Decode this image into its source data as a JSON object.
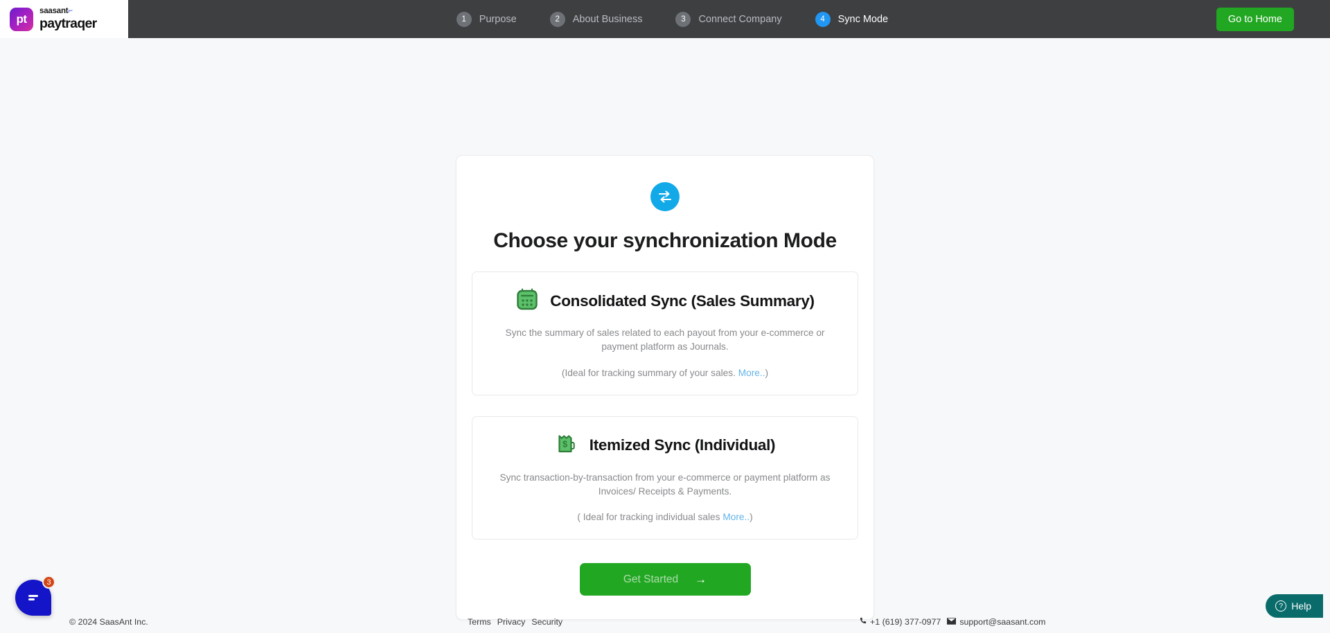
{
  "header": {
    "logo": {
      "mark_text": "pt",
      "brand_small": "saasant",
      "brand_large": "paytraqer"
    },
    "steps": [
      {
        "num": "1",
        "label": "Purpose",
        "active": false
      },
      {
        "num": "2",
        "label": "About Business",
        "active": false
      },
      {
        "num": "3",
        "label": "Connect Company",
        "active": false
      },
      {
        "num": "4",
        "label": "Sync Mode",
        "active": true
      }
    ],
    "home_button": "Go to Home",
    "colors": {
      "bar": "#3d3f41",
      "active_step": "#2196f3",
      "inactive_step": "#6e7277",
      "home_green": "#22a722"
    }
  },
  "card": {
    "sync_icon": "sync-arrows-icon",
    "title": "Choose your synchronization Mode",
    "options": [
      {
        "icon": "calendar-icon",
        "title": "Consolidated Sync (Sales Summary)",
        "description": "Sync the summary of sales related to each payout from your e-commerce or payment platform as Journals.",
        "note_prefix": "(Ideal for tracking summary of your sales. ",
        "note_link": "More..",
        "note_suffix": ")"
      },
      {
        "icon": "money-receipt-icon",
        "title": "Itemized Sync (Individual)",
        "description": "Sync transaction-by-transaction from your e-commerce or payment platform as Invoices/ Receipts & Payments.",
        "note_prefix": "( Ideal for tracking individual sales ",
        "note_link": "More..",
        "note_suffix": ")"
      }
    ],
    "cta_label": "Get Started",
    "cta_arrow": "→"
  },
  "footer": {
    "copyright": "© 2024 SaasAnt Inc.",
    "links": [
      "Terms",
      "Privacy",
      "Security"
    ],
    "phone": "+1 (619) 377-0977",
    "email": "support@saasant.com"
  },
  "widgets": {
    "chat_badge_count": "3",
    "help_label": "Help",
    "help_mark": "?"
  }
}
